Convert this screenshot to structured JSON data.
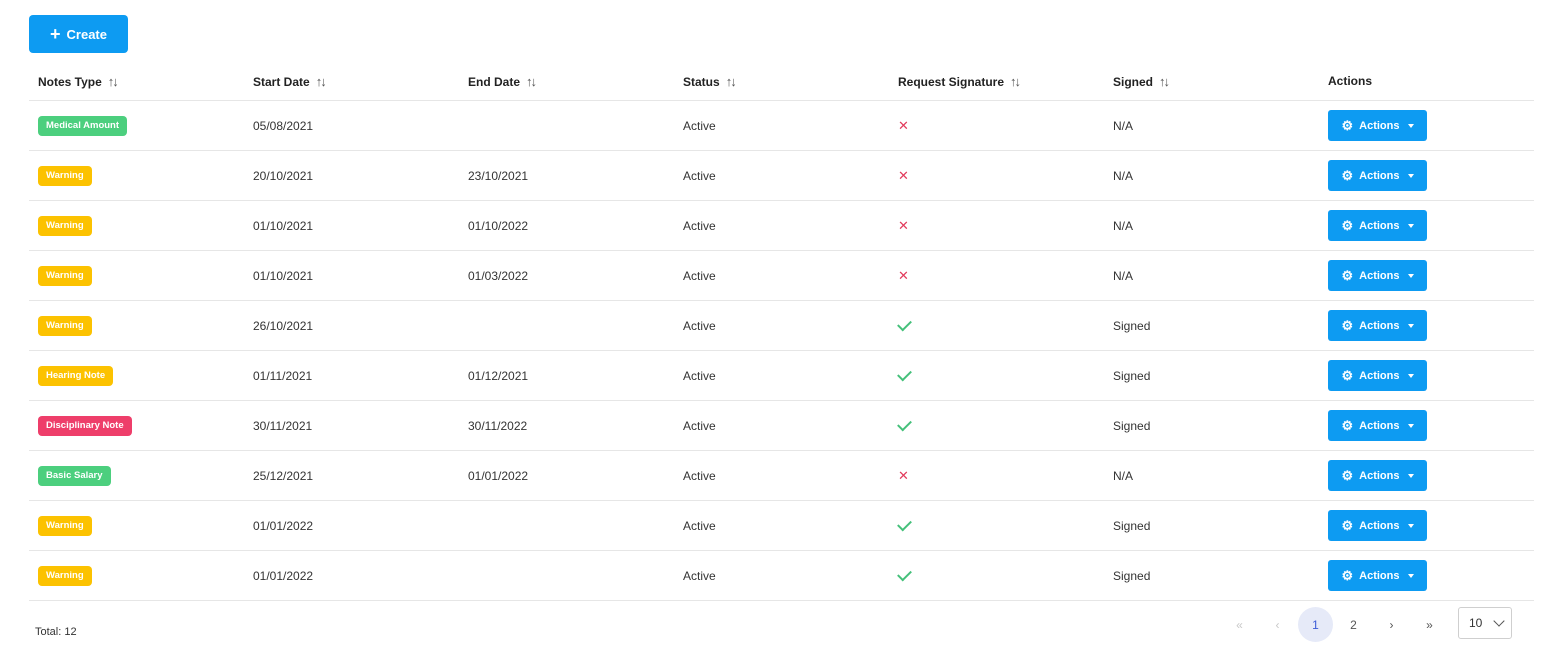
{
  "toolbar": {
    "create_label": "Create"
  },
  "table": {
    "columns": [
      "Notes Type",
      "Start Date",
      "End Date",
      "Status",
      "Request Signature",
      "Signed",
      "Actions"
    ],
    "rows": [
      {
        "type": "Medical Amount",
        "type_color": "green",
        "start": "05/08/2021",
        "end": "",
        "status": "Active",
        "request_signature": false,
        "signed": "N/A",
        "actions_label": "Actions"
      },
      {
        "type": "Warning",
        "type_color": "yellow",
        "start": "20/10/2021",
        "end": "23/10/2021",
        "status": "Active",
        "request_signature": false,
        "signed": "N/A",
        "actions_label": "Actions"
      },
      {
        "type": "Warning",
        "type_color": "yellow",
        "start": "01/10/2021",
        "end": "01/10/2022",
        "status": "Active",
        "request_signature": false,
        "signed": "N/A",
        "actions_label": "Actions"
      },
      {
        "type": "Warning",
        "type_color": "yellow",
        "start": "01/10/2021",
        "end": "01/03/2022",
        "status": "Active",
        "request_signature": false,
        "signed": "N/A",
        "actions_label": "Actions"
      },
      {
        "type": "Warning",
        "type_color": "yellow",
        "start": "26/10/2021",
        "end": "",
        "status": "Active",
        "request_signature": true,
        "signed": "Signed",
        "actions_label": "Actions"
      },
      {
        "type": "Hearing Note",
        "type_color": "yellow",
        "start": "01/11/2021",
        "end": "01/12/2021",
        "status": "Active",
        "request_signature": true,
        "signed": "Signed",
        "actions_label": "Actions"
      },
      {
        "type": "Disciplinary Note",
        "type_color": "red",
        "start": "30/11/2021",
        "end": "30/11/2022",
        "status": "Active",
        "request_signature": true,
        "signed": "Signed",
        "actions_label": "Actions"
      },
      {
        "type": "Basic Salary",
        "type_color": "green",
        "start": "25/12/2021",
        "end": "01/01/2022",
        "status": "Active",
        "request_signature": false,
        "signed": "N/A",
        "actions_label": "Actions"
      },
      {
        "type": "Warning",
        "type_color": "yellow",
        "start": "01/01/2022",
        "end": "",
        "status": "Active",
        "request_signature": true,
        "signed": "Signed",
        "actions_label": "Actions"
      },
      {
        "type": "Warning",
        "type_color": "yellow",
        "start": "01/01/2022",
        "end": "",
        "status": "Active",
        "request_signature": true,
        "signed": "Signed",
        "actions_label": "Actions"
      }
    ]
  },
  "footer": {
    "total_label": "Total: 12",
    "pagination": {
      "first": "«",
      "prev": "‹",
      "pages": [
        "1",
        "2"
      ],
      "current": "1",
      "next": "›",
      "last": "»"
    },
    "per_page": "10"
  },
  "colors": {
    "primary": "#0d9bf2",
    "badge_green": "#4ccf7e",
    "badge_yellow": "#fcc200",
    "badge_red": "#ee3e6a",
    "cross": "#e23a5c",
    "check": "#45c07a"
  },
  "icons": {
    "create": "plus-icon",
    "sort": "sort-icon",
    "actions": "gear-icon",
    "dropdown": "caret-down-icon",
    "no_signature": "cross-icon",
    "has_signature": "check-icon"
  }
}
